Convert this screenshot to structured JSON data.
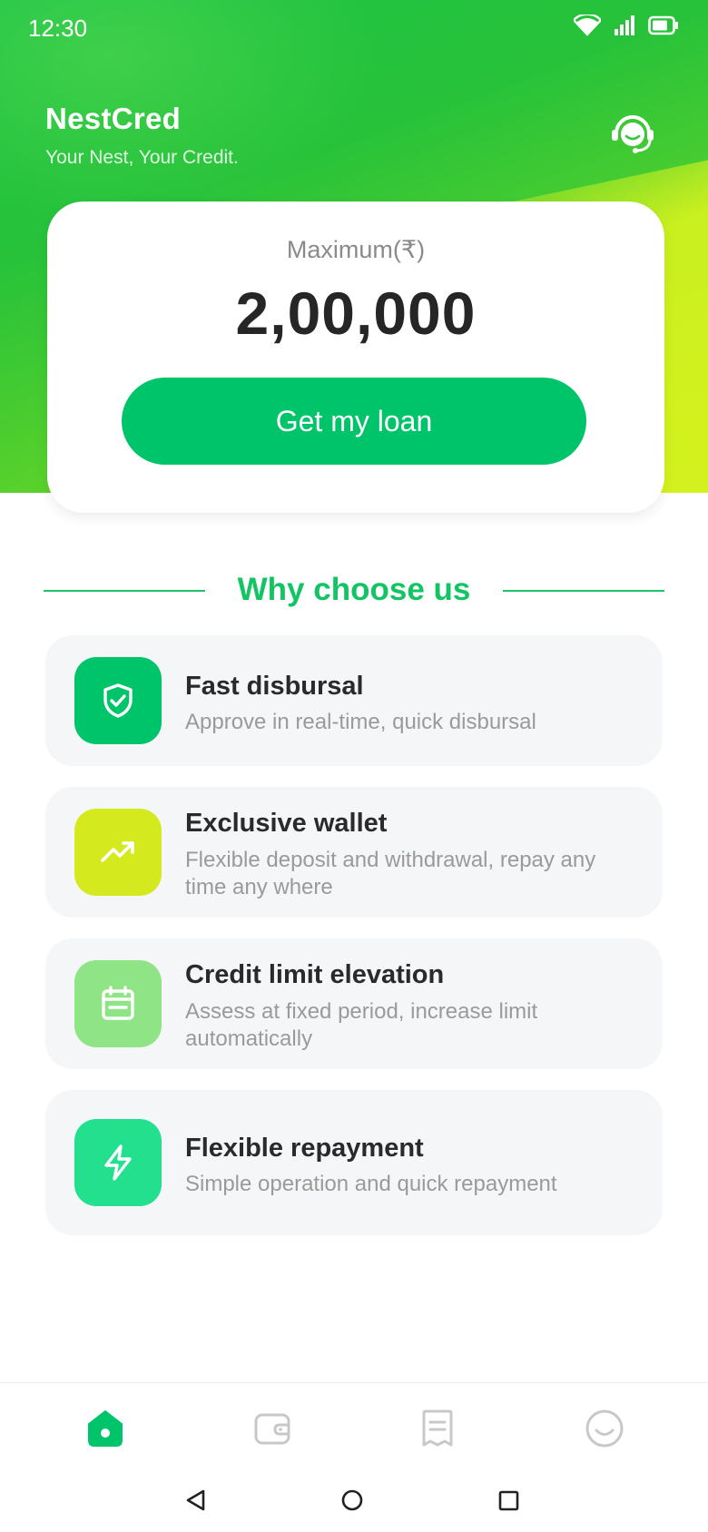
{
  "status_bar": {
    "time": "12:30"
  },
  "header": {
    "brand_name": "NestCred",
    "tagline": "Your Nest, Your Credit."
  },
  "loan_card": {
    "label": "Maximum(₹)",
    "amount": "2,00,000",
    "button_label": "Get my loan"
  },
  "section": {
    "title": "Why choose us"
  },
  "features": [
    {
      "title": "Fast disbursal",
      "description": "Approve in real-time, quick disbursal",
      "icon": "shield-check-icon",
      "color": "#00c46a"
    },
    {
      "title": "Exclusive wallet",
      "description": "Flexible deposit and withdrawal, repay any time any where",
      "icon": "trending-up-icon",
      "color": "#d4ea1f"
    },
    {
      "title": "Credit limit elevation",
      "description": "Assess at fixed period, increase limit automatically",
      "icon": "calendar-icon",
      "color": "#8fe486"
    },
    {
      "title": "Flexible repayment",
      "description": "Simple operation and quick repayment",
      "icon": "lightning-icon",
      "color": "#22e08e"
    }
  ],
  "bottom_nav": {
    "items": [
      {
        "icon": "home-icon",
        "active": true
      },
      {
        "icon": "wallet-icon",
        "active": false
      },
      {
        "icon": "orders-icon",
        "active": false
      },
      {
        "icon": "profile-icon",
        "active": false
      }
    ],
    "active_color": "#00c46a",
    "inactive_color": "#c8c8c8"
  },
  "colors": {
    "brand_green": "#00c46a",
    "accent_title": "#12c463"
  }
}
